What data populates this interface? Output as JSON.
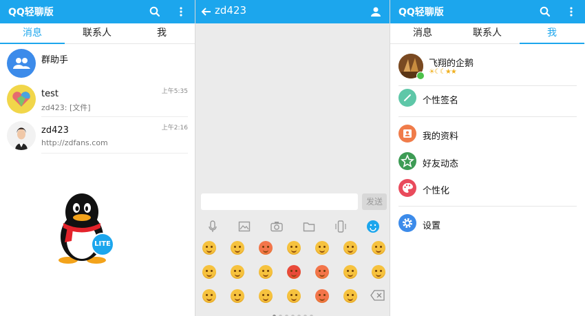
{
  "left": {
    "app_title": "QQ轻聊版",
    "tabs": [
      "消息",
      "联系人",
      "我"
    ],
    "conversations": [
      {
        "name": "群助手",
        "message": "",
        "time": ""
      },
      {
        "name": "test",
        "message": "zd423: [文件]",
        "time": "上午5:35"
      },
      {
        "name": "zd423",
        "message": "http://zdfans.com",
        "time": "上午2:16"
      }
    ],
    "lite_badge": "LITE"
  },
  "middle": {
    "chat_title": "zd423",
    "input_placeholder": "",
    "send_label": "发送",
    "tools": [
      "mic-icon",
      "image-icon",
      "camera-icon",
      "folder-icon",
      "shake-icon",
      "emoji-icon"
    ],
    "emoji_rows": 3,
    "emoji_cols": 7,
    "page_dots": 7,
    "active_dot": 0
  },
  "right": {
    "app_title": "QQ轻聊版",
    "tabs": [
      "消息",
      "联系人",
      "我"
    ],
    "profile_name": "飞翔的企鹅",
    "menu": [
      "个性签名",
      "我的资料",
      "好友动态",
      "个性化",
      "设置"
    ]
  },
  "colors": {
    "accent": "#1ca6ed",
    "signature": "#5ec7a8",
    "profile": "#f07c4a",
    "moments": "#3d9b54",
    "personalize": "#e94b5c",
    "settings": "#3c8bea"
  }
}
